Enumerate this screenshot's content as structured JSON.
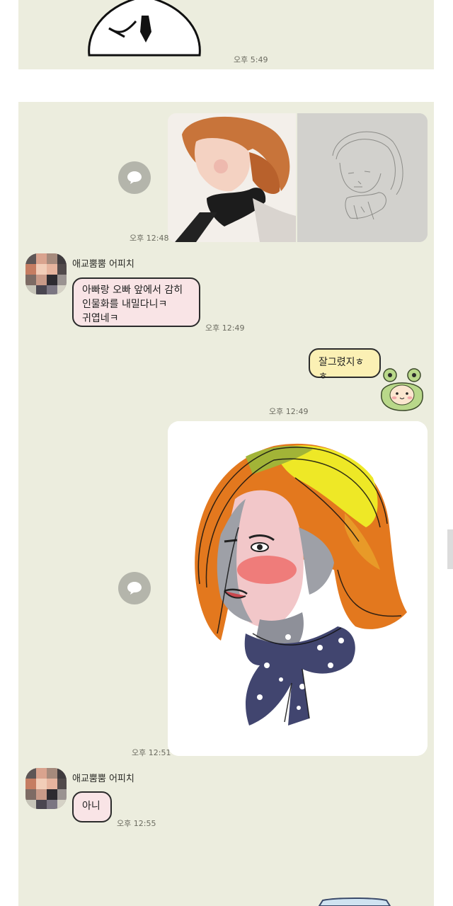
{
  "top_section": {
    "time": "오후 5:49"
  },
  "messages": {
    "photos": {
      "time": "오후 12:48"
    },
    "reply1": {
      "sender": "애교뿜뿜 어피치",
      "lines": [
        "아빠랑 오빠 앞에서 감히",
        "인물화를 내밀다니ㅋ",
        "귀엽네ㅋ"
      ],
      "time": "오후 12:49"
    },
    "mine1": {
      "text": "잘그렸지ㅎㅎ",
      "time": "오후 12:49"
    },
    "drawing": {
      "time": "오후 12:51"
    },
    "reply2": {
      "sender": "애교뿜뿜 어피치",
      "text": "아니",
      "time": "오후 12:55"
    }
  },
  "icons": [
    "share-icon",
    "frog-sticker"
  ],
  "colors": {
    "chat_bg": "#ecedde",
    "incoming_bubble": "#f9e4e6",
    "outgoing_bubble": "#fbf0b4"
  }
}
